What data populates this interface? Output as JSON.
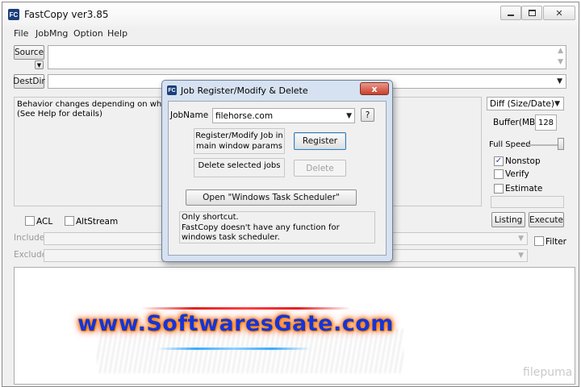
{
  "window": {
    "title": "FastCopy ver3.85",
    "icon_text": "FC"
  },
  "menu": [
    "File",
    "JobMng",
    "Option",
    "Help"
  ],
  "main": {
    "source_button": "Source",
    "destdir_button": "DestDir",
    "info_text": "Behavior changes depending on whether or n",
    "info_text2": "(See Help for details)",
    "mode_select": "Diff (Size/Date)",
    "buffer_label": "Buffer(MB)",
    "buffer_value": "128",
    "speed_label": "Full Speed",
    "options": [
      {
        "label": "Nonstop",
        "checked": true
      },
      {
        "label": "Verify",
        "checked": false
      },
      {
        "label": "Estimate",
        "checked": false
      }
    ],
    "listing_button": "Listing",
    "execute_button": "Execute",
    "acl_label": "ACL",
    "altstream_label": "AltStream",
    "include_label": "Include",
    "exclude_label": "Exclude",
    "filter_label": "Filter"
  },
  "dialog": {
    "title": "Job Register/Modify & Delete",
    "jobname_label": "JobName",
    "jobname_value": "filehorse.com",
    "help_button": "?",
    "register_note": "Register/Modify Job in main window params",
    "register_button": "Register",
    "delete_note": "Delete selected jobs",
    "delete_button": "Delete",
    "scheduler_button": "Open \"Windows Task Scheduler\"",
    "info_line1": "Only shortcut.",
    "info_line2": "FastCopy doesn't have any function for windows task scheduler.",
    "close_symbol": "x"
  },
  "watermark": {
    "text": "www.SoftwaresGate.com",
    "corner_text": "filepuma"
  },
  "colors": {
    "watermark_text": "#1535d9",
    "watermark_glow": "#ff6a00",
    "dialog_frame": "#d6e2f1",
    "close_button": "#c9402c"
  }
}
